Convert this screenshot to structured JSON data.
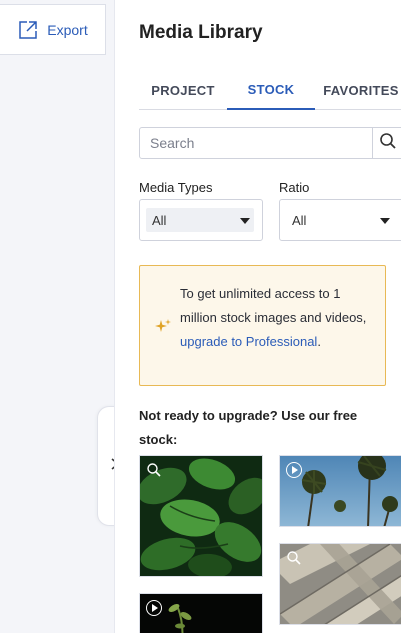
{
  "export_button": {
    "label": "Export",
    "icon": "export-icon"
  },
  "panel": {
    "title": "Media Library",
    "tabs": [
      {
        "label": "PROJECT",
        "active": false
      },
      {
        "label": "STOCK",
        "active": true
      },
      {
        "label": "FAVORITES",
        "active": false
      }
    ]
  },
  "search": {
    "placeholder": "Search",
    "value": "",
    "icon": "search-icon"
  },
  "filters": {
    "media_types": {
      "label": "Media Types",
      "selected": "All"
    },
    "ratio": {
      "label": "Ratio",
      "selected": "All"
    }
  },
  "promo": {
    "text": "To get unlimited access to 1 million stock images and videos,",
    "link": "upgrade to Professional",
    "suffix": ".",
    "icon": "sparkle-icon",
    "accent_border": "#e8b955",
    "background": "#fdf7ea"
  },
  "free_stock": {
    "text": "Not ready to upgrade? Use our free stock:"
  },
  "thumbnails": [
    {
      "kind": "image",
      "subject": "basil leaves",
      "overlay_icon": "zoom-icon"
    },
    {
      "kind": "video",
      "subject": "palm trees sky",
      "overlay_icon": "play-icon"
    },
    {
      "kind": "image",
      "subject": "wooden planks",
      "overlay_icon": "zoom-icon"
    },
    {
      "kind": "video",
      "subject": "sprouting plant",
      "overlay_icon": "play-icon"
    }
  ],
  "collapse_toggle": {
    "icon": "chevron-right-icon"
  },
  "colors": {
    "accent": "#2b5cb8",
    "border": "#cfd2dc"
  }
}
